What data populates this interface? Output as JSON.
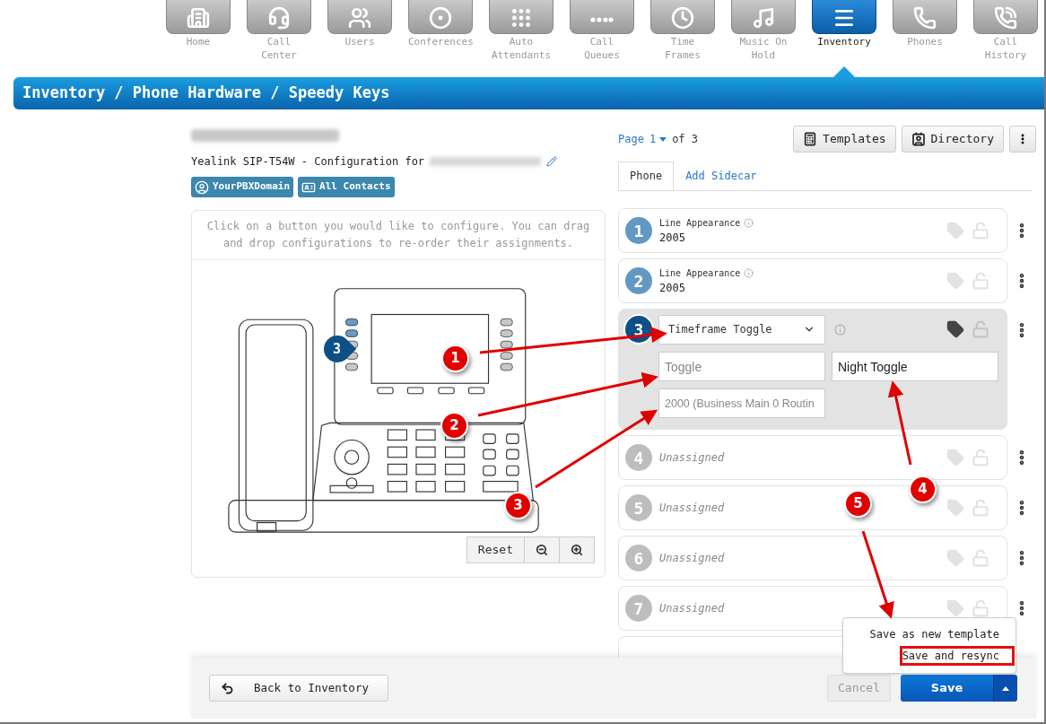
{
  "nav": [
    {
      "label": "Home",
      "selected": false
    },
    {
      "label": "Call Center",
      "selected": false
    },
    {
      "label": "Users",
      "selected": false
    },
    {
      "label": "Conferences",
      "selected": false
    },
    {
      "label": "Auto Attendants",
      "selected": false
    },
    {
      "label": "Call Queues",
      "selected": false
    },
    {
      "label": "Time Frames",
      "selected": false
    },
    {
      "label": "Music On Hold",
      "selected": false
    },
    {
      "label": "Inventory",
      "selected": true
    },
    {
      "label": "Phones",
      "selected": false
    },
    {
      "label": "Call History",
      "selected": false
    }
  ],
  "breadcrumb": "Inventory / Phone Hardware / Speedy Keys",
  "device": {
    "model_line": "Yealink SIP-T54W - Configuration for",
    "tags": [
      "YourPBXDomain",
      "All Contacts"
    ]
  },
  "instructions": "Click on a button you would like to configure. You can drag and drop configurations to re-order their assignments.",
  "phone_pin": "3",
  "zoom_controls": {
    "reset": "Reset"
  },
  "pager": {
    "prefix": "Page",
    "page": "1",
    "suffix": "of 3"
  },
  "toolbar": [
    "Templates",
    "Directory"
  ],
  "tabs": [
    {
      "label": "Phone",
      "selected": true
    },
    {
      "label": "Add Sidecar",
      "selected": false
    }
  ],
  "keys": [
    {
      "number": "1",
      "kind": "line",
      "type": "Line Appearance",
      "value": "2005",
      "tagged": false,
      "selected": false
    },
    {
      "number": "2",
      "kind": "line",
      "type": "Line Appearance",
      "value": "2005",
      "tagged": false,
      "selected": false
    },
    {
      "number": "3",
      "kind": "editor",
      "type": "Timeframe Toggle",
      "tagged": true,
      "selected": true,
      "fields": [
        {
          "placeholder": "Toggle"
        },
        {
          "value": "Night Toggle"
        },
        {
          "placeholder": "2000 (Business Main 0 Routin"
        }
      ]
    },
    {
      "number": "4",
      "kind": "unassigned",
      "value": "Unassigned",
      "tagged": false,
      "selected": false
    },
    {
      "number": "5",
      "kind": "unassigned",
      "value": "Unassigned",
      "tagged": false,
      "selected": false
    },
    {
      "number": "6",
      "kind": "unassigned",
      "value": "Unassigned",
      "tagged": false,
      "selected": false
    },
    {
      "number": "7",
      "kind": "unassigned",
      "value": "Unassigned",
      "tagged": false,
      "selected": false
    }
  ],
  "footer": {
    "back": "Back to Inventory",
    "cancel": "Cancel",
    "save": "Save"
  },
  "save_menu": [
    {
      "label": "Save as new template",
      "selected": false
    },
    {
      "label": "Save and resync",
      "selected": true
    }
  ],
  "annotations": [
    "1",
    "2",
    "3",
    "4",
    "5"
  ]
}
